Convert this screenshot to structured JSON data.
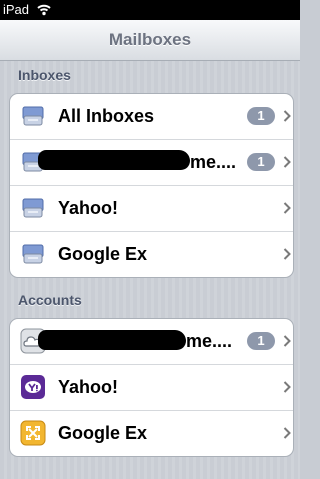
{
  "status_bar": {
    "carrier": "iPad"
  },
  "nav": {
    "title": "Mailboxes"
  },
  "inboxes": {
    "header": "Inboxes",
    "items": [
      {
        "label": "All Inboxes",
        "badge": "1"
      },
      {
        "label_suffix": "me....",
        "badge": "1"
      },
      {
        "label": "Yahoo!"
      },
      {
        "label": "Google Ex"
      }
    ]
  },
  "accounts": {
    "header": "Accounts",
    "items": [
      {
        "label_suffix": "me....",
        "badge": "1"
      },
      {
        "label": "Yahoo!"
      },
      {
        "label": "Google Ex"
      }
    ]
  },
  "icons": {
    "inbox": "inbox-tray-icon",
    "mobileme": "cloud-icon",
    "yahoo": "yahoo-icon",
    "exchange": "exchange-icon",
    "chevron": "chevron-right-icon"
  }
}
